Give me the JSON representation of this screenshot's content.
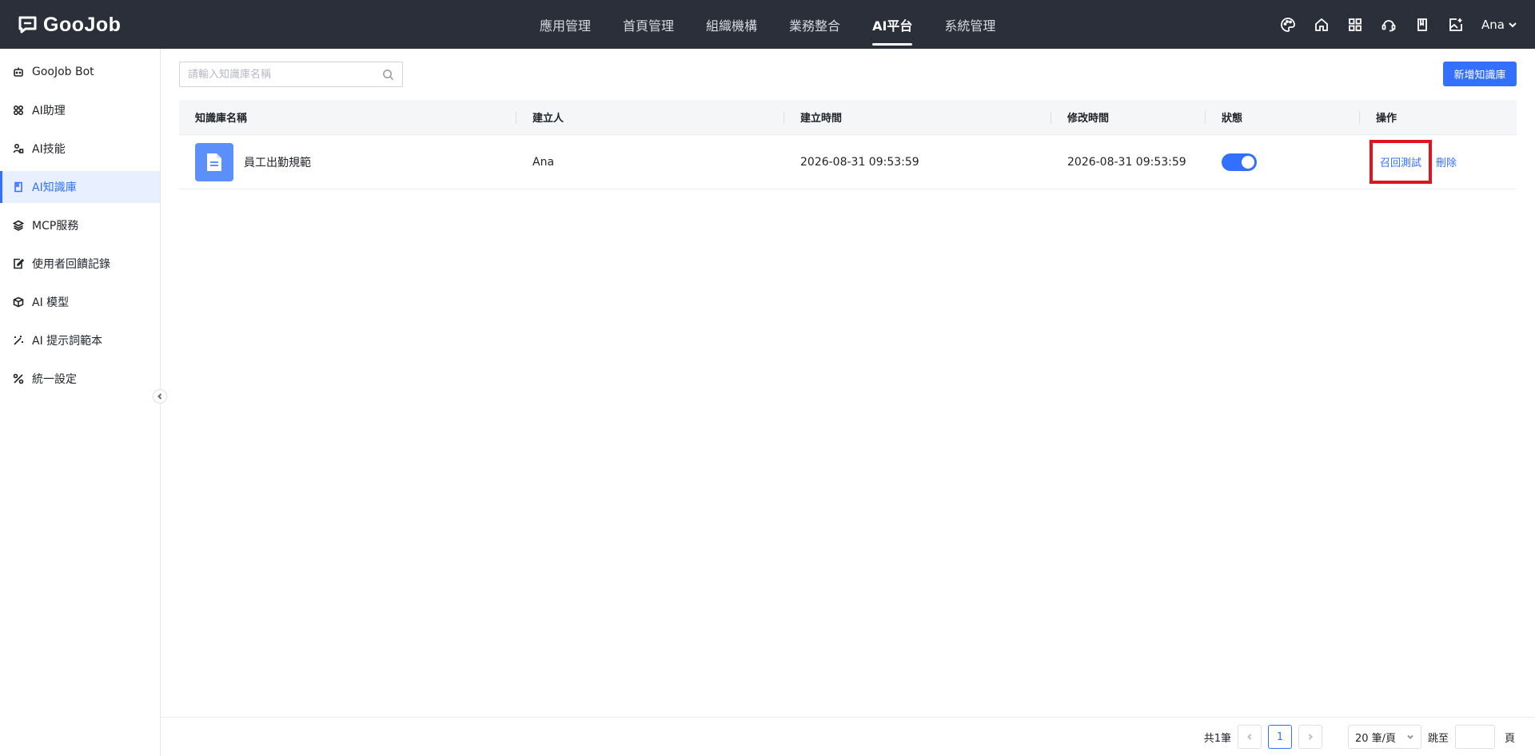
{
  "header": {
    "logo_text": "GooJob",
    "nav": [
      {
        "label": "應用管理",
        "active": false
      },
      {
        "label": "首頁管理",
        "active": false
      },
      {
        "label": "組織機構",
        "active": false
      },
      {
        "label": "業務整合",
        "active": false
      },
      {
        "label": "AI平台",
        "active": true
      },
      {
        "label": "系統管理",
        "active": false
      }
    ],
    "icons": [
      "palette-icon",
      "home-icon",
      "apps-grid-icon",
      "headset-icon",
      "book-icon",
      "image-add-icon"
    ],
    "user_name": "Ana"
  },
  "sidebar": {
    "items": [
      {
        "label": "GooJob Bot",
        "icon": "robot-icon",
        "active": false
      },
      {
        "label": "AI助理",
        "icon": "grid-icon",
        "active": false
      },
      {
        "label": "AI技能",
        "icon": "skill-icon",
        "active": false
      },
      {
        "label": "AI知識庫",
        "icon": "book-icon",
        "active": true
      },
      {
        "label": "MCP服務",
        "icon": "layers-icon",
        "active": false
      },
      {
        "label": "使用者回饋記錄",
        "icon": "feedback-icon",
        "active": false
      },
      {
        "label": "AI 模型",
        "icon": "cube-icon",
        "active": false
      },
      {
        "label": "AI 提示詞範本",
        "icon": "magic-wand-icon",
        "active": false
      },
      {
        "label": "統一設定",
        "icon": "tools-icon",
        "active": false
      }
    ]
  },
  "main": {
    "search_placeholder": "請輸入知識庫名稱",
    "add_button_label": "新增知識庫",
    "table": {
      "columns": [
        "知識庫名稱",
        "建立人",
        "建立時間",
        "修改時間",
        "狀態",
        "操作"
      ],
      "rows": [
        {
          "name": "員工出勤規範",
          "creator": "Ana",
          "created_at": "2026-08-31 09:53:59",
          "modified_at": "2026-08-31 09:53:59",
          "enabled": true,
          "actions": [
            "召回測試",
            "刪除"
          ]
        }
      ]
    },
    "pagination": {
      "total_text": "共1筆",
      "current_page": "1",
      "page_size": "20 筆/頁",
      "jump_label": "跳至",
      "page_unit": "頁"
    }
  },
  "colors": {
    "topbar": "#2b2f3a",
    "accent": "#3370ff",
    "highlight": "#e0141e"
  }
}
